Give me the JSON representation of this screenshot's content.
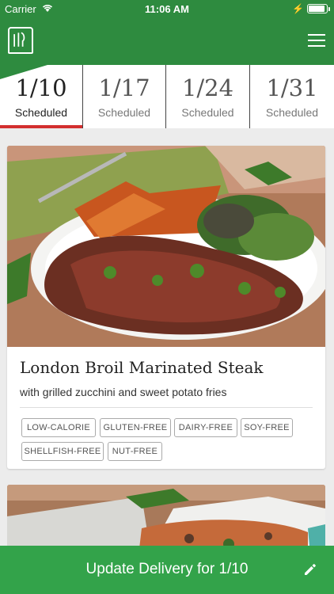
{
  "status_bar": {
    "carrier": "Carrier",
    "time": "11:06 AM"
  },
  "nav": {
    "logo_icon": "chef-logo-icon",
    "menu_icon": "hamburger-menu-icon"
  },
  "tabs": [
    {
      "date": "1/10",
      "label": "Scheduled",
      "active": true
    },
    {
      "date": "1/17",
      "label": "Scheduled",
      "active": false
    },
    {
      "date": "1/24",
      "label": "Scheduled",
      "active": false
    },
    {
      "date": "1/31",
      "label": "Scheduled",
      "active": false
    }
  ],
  "recipe": {
    "title": "London Broil Marinated Steak",
    "subtitle": "with grilled zucchini and sweet potato fries",
    "tags": [
      "LOW-CALORIE",
      "GLUTEN-FREE",
      "DAIRY-FREE",
      "SOY-FREE",
      "SHELLFISH-FREE",
      "NUT-FREE"
    ]
  },
  "footer": {
    "label": "Update Delivery for 1/10",
    "icon": "pencil-edit-icon"
  },
  "colors": {
    "brand_green": "#2e8b3f",
    "footer_green": "#33a34a",
    "active_tab_indicator": "#d32f2f"
  }
}
